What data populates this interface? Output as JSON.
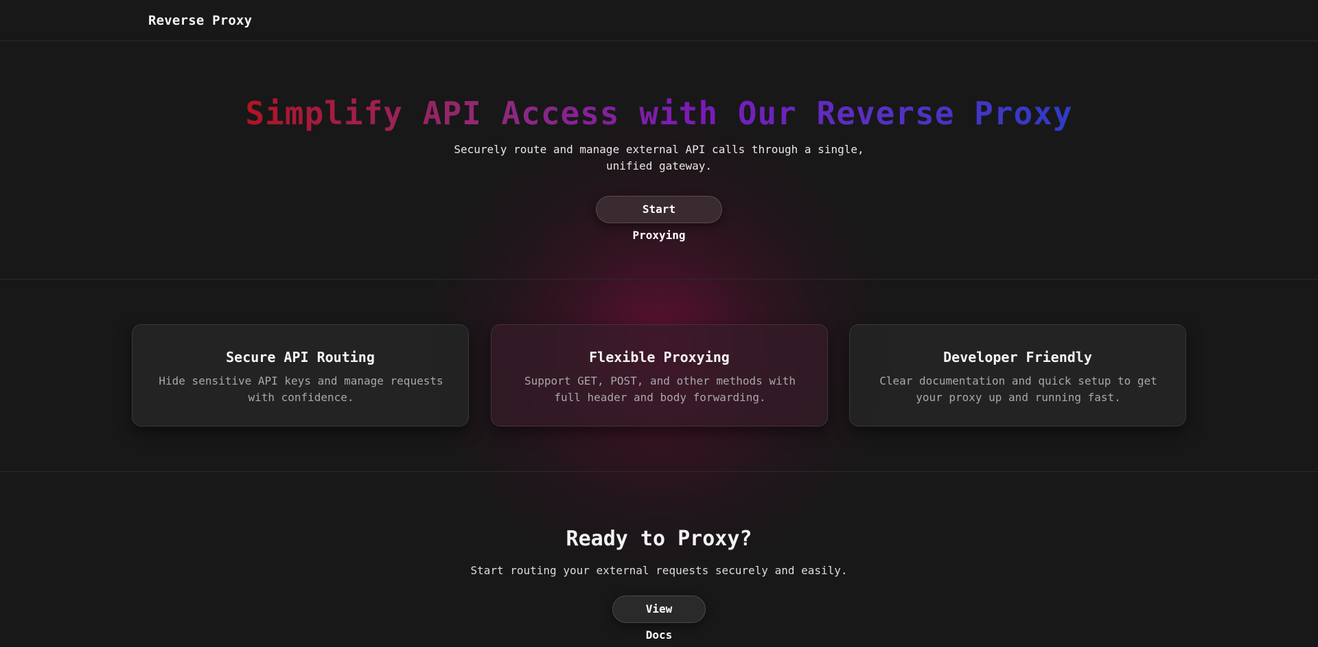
{
  "header": {
    "brand": "Reverse Proxy"
  },
  "hero": {
    "title": "Simplify API Access with Our Reverse Proxy",
    "subtitle": "Securely route and manage external API calls through a single, unified gateway.",
    "cta_label": "Start Proxying"
  },
  "features": [
    {
      "title": "Secure API Routing",
      "description": "Hide sensitive API keys and manage requests with confidence."
    },
    {
      "title": "Flexible Proxying",
      "description": "Support GET, POST, and other methods with full header and body forwarding."
    },
    {
      "title": "Developer Friendly",
      "description": "Clear documentation and quick setup to get your proxy up and running fast."
    }
  ],
  "cta": {
    "title": "Ready to Proxy?",
    "subtitle": "Start routing your external requests securely and easily.",
    "button_label": "View Docs"
  },
  "colors": {
    "background": "#181818",
    "title_gradient_start": "#b01424",
    "title_gradient_end": "#2e3cc8",
    "glow": "#960a46"
  }
}
